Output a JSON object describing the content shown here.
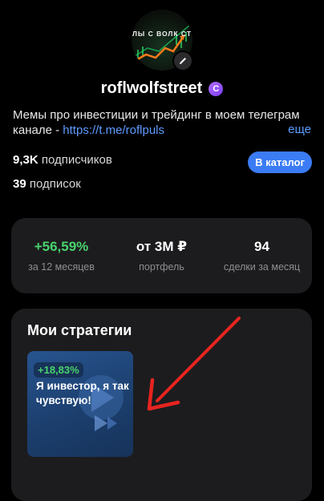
{
  "profile": {
    "avatar_text": "ЛЫ С ВОЛК СТ",
    "username": "roflwolfstreet",
    "badge_glyph": "C",
    "bio_text": "Мемы про инвестиции и трейдинг в моем телеграм канале - ",
    "bio_link": "https://t.me/roflpuls",
    "more_label": "еще",
    "subscribers_count": "9,3K",
    "subscribers_label": "подписчиков",
    "subscriptions_count": "39",
    "subscriptions_label": "подписок",
    "catalog_button": "В каталог"
  },
  "metrics": [
    {
      "value": "+56,59%",
      "label": "за 12 месяцев",
      "color": "#49d36d"
    },
    {
      "value": "от 3М ₽",
      "label": "портфель",
      "color": "#ffffff"
    },
    {
      "value": "94",
      "label": "сделки за месяц",
      "color": "#ffffff"
    }
  ],
  "strategies": {
    "title": "Мои стратегии",
    "items": [
      {
        "percent": "+18,83%",
        "name": "Я инвестор, я так чувствую!"
      }
    ]
  },
  "colors": {
    "accent": "#3b7cf5",
    "link": "#5d9bff",
    "positive": "#49d36d",
    "card_bg": "#1c1c1e",
    "annotation_arrow": "#e8241f"
  },
  "icons": {
    "edit": "pencil-icon",
    "badge": "verified-badge-icon",
    "annotation": "red-arrow-icon"
  }
}
